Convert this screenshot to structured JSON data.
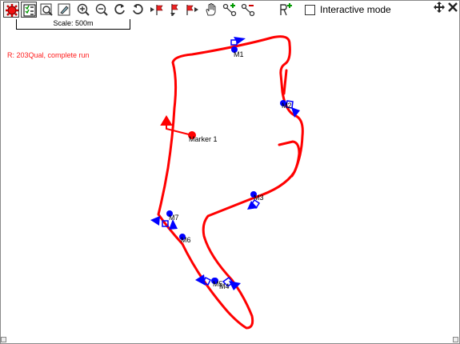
{
  "toolbar": {
    "buttons": [
      {
        "name": "map-settings-button",
        "icon": "red-gear-icon",
        "active": true
      },
      {
        "name": "checklist-button",
        "icon": "checklist-icon",
        "active": true
      },
      {
        "name": "zoom-region-button",
        "icon": "zoom-region-icon",
        "active": false
      },
      {
        "name": "draw-track-button",
        "icon": "pencil-icon",
        "active": false
      },
      {
        "name": "zoom-in-button",
        "icon": "zoom-in-icon",
        "active": false
      },
      {
        "name": "zoom-out-button",
        "icon": "zoom-out-icon",
        "active": false
      },
      {
        "name": "rotate-cw-button",
        "icon": "rotate-cw-icon",
        "active": false
      },
      {
        "name": "rotate-ccw-button",
        "icon": "rotate-ccw-icon",
        "active": false
      },
      {
        "name": "prev-marker-button",
        "icon": "prev-flag-icon",
        "active": false
      },
      {
        "name": "marker-down-button",
        "icon": "down-flag-icon",
        "active": false
      },
      {
        "name": "next-marker-button",
        "icon": "next-flag-icon",
        "active": false
      },
      {
        "name": "pan-button",
        "icon": "hand-icon",
        "active": false
      },
      {
        "name": "add-marker-button",
        "icon": "add-node-icon",
        "active": false
      },
      {
        "name": "remove-marker-button",
        "icon": "remove-node-icon",
        "active": false
      },
      {
        "name": "reset-button",
        "icon": "reset-icon",
        "active": false
      }
    ],
    "interactive_mode_label": "Interactive mode",
    "interactive_mode_checked": false
  },
  "scale": {
    "label": "Scale: 500m"
  },
  "run": {
    "label": "R:  203Qual, complete run",
    "color": "#ff1a1a"
  },
  "track_color": "#ff0000",
  "marker_color": "#0000ff",
  "markers": [
    {
      "id": "m1",
      "label": "M1"
    },
    {
      "id": "m2",
      "label": "M2"
    },
    {
      "id": "m3",
      "label": "M3"
    },
    {
      "id": "m4",
      "label": "M4"
    },
    {
      "id": "m5",
      "label": "M5"
    },
    {
      "id": "m6",
      "label": "M6"
    },
    {
      "id": "m7",
      "label": "M7"
    },
    {
      "id": "marker1",
      "label": "Marker 1"
    }
  ]
}
